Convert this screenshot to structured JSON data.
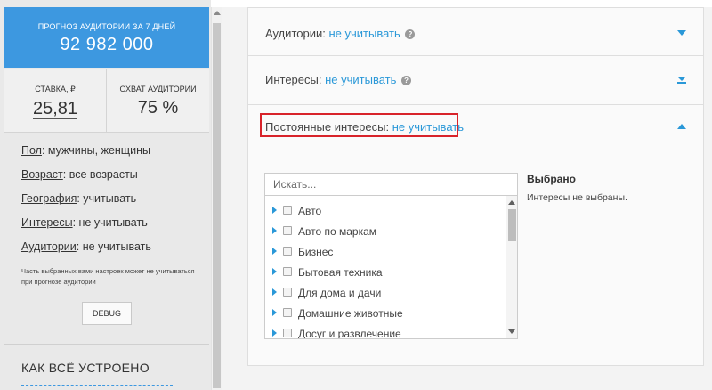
{
  "forecast": {
    "label": "ПРОГНОЗ АУДИТОРИИ ЗА 7 ДНЕЙ",
    "value": "92 982 000"
  },
  "stats": {
    "bid_label": "СТАВКА, ₽",
    "bid_value": "25,81",
    "reach_label": "ОХВАТ АУДИТОРИИ",
    "reach_value": "75 %"
  },
  "settings": [
    {
      "key": "Пол",
      "value": ": мужчины, женщины"
    },
    {
      "key": "Возраст",
      "value": ": все возрасты"
    },
    {
      "key": "География",
      "value": ": учитывать"
    },
    {
      "key": "Интересы",
      "value": ": не учитывать"
    },
    {
      "key": "Аудитории",
      "value": ": не учитывать"
    }
  ],
  "note": "Часть выбранных вами настроек может не учитываться при прогнозе аудитории",
  "debug_label": "DEBUG",
  "howto_title": "КАК ВСЁ УСТРОЕНО",
  "accordion": [
    {
      "title": "Аудитории: ",
      "link": "не учитывать",
      "help": "?"
    },
    {
      "title": "Интересы: ",
      "link": "не учитывать",
      "help": "?"
    },
    {
      "title": "Постоянные интересы: ",
      "link": "не учитывать"
    }
  ],
  "search": {
    "placeholder": "Искать..."
  },
  "categories": [
    "Авто",
    "Авто по маркам",
    "Бизнес",
    "Бытовая техника",
    "Для дома и дачи",
    "Домашние животные",
    "Досуг и развлечение"
  ],
  "selected": {
    "title": "Выбрано",
    "empty_text": "Интересы не выбраны."
  },
  "colors": {
    "accent": "#2a98d8",
    "forecast_bg": "#3d98e0",
    "highlight": "#d8232a"
  }
}
